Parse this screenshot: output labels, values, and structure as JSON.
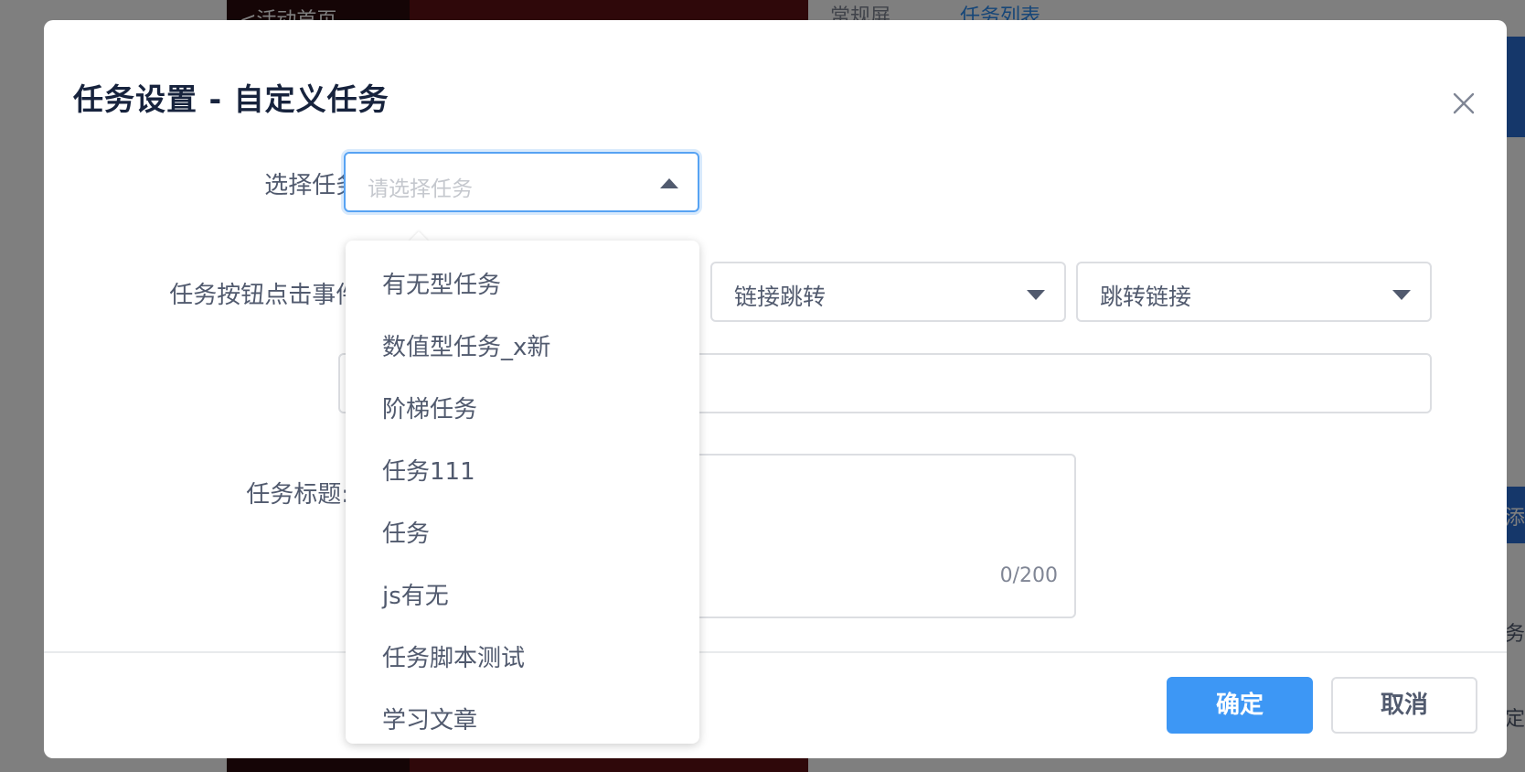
{
  "background": {
    "top_left_text": "<活动首页",
    "top_mid_text": "常规屏",
    "top_tab_text": "任务列表",
    "side_fragment_1": "添",
    "side_fragment_2": "务",
    "side_fragment_3": "定"
  },
  "dialog": {
    "title": "任务设置 - 自定义任务",
    "close_icon": "close-icon"
  },
  "form": {
    "select_task_label": "选择任务:",
    "select_task_placeholder": "请选择任务",
    "click_event_label": "任务按钮点击事件:",
    "click_event_type": "链接跳转",
    "click_event_target": "跳转链接",
    "task_title_label": "任务标题:",
    "task_title_counter": "0/200"
  },
  "dropdown": {
    "options": [
      "有无型任务",
      "数值型任务_x新",
      "阶梯任务",
      "任务111",
      "任务",
      "js有无",
      "任务脚本测试",
      "学习文章"
    ]
  },
  "footer": {
    "confirm_label": "确定",
    "cancel_label": "取消"
  },
  "colors": {
    "primary": "#3d97f5",
    "focus_border": "#57a3f3",
    "text": "#515a6e",
    "placeholder": "#c5c8ce"
  }
}
